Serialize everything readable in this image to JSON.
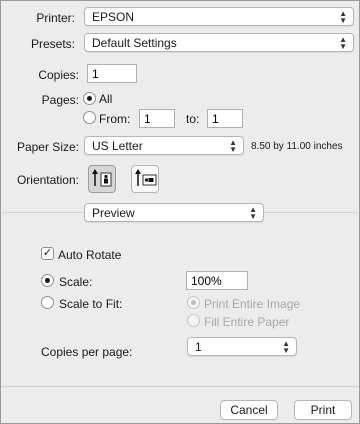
{
  "printer": {
    "label": "Printer:",
    "value": "EPSON"
  },
  "presets": {
    "label": "Presets:",
    "value": "Default Settings"
  },
  "copies": {
    "label": "Copies:",
    "value": "1"
  },
  "pages": {
    "label": "Pages:",
    "all_label": "All",
    "from_label": "From:",
    "from_value": "1",
    "to_label": "to:",
    "to_value": "1"
  },
  "paper_size": {
    "label": "Paper Size:",
    "value": "US Letter",
    "dimensions": "8.50 by 11.00 inches"
  },
  "orientation": {
    "label": "Orientation:",
    "selected": "portrait"
  },
  "section_select": {
    "value": "Preview"
  },
  "preview": {
    "auto_rotate_label": "Auto Rotate",
    "auto_rotate_checked": true,
    "scale_label": "Scale:",
    "scale_value": "100%",
    "scale_to_fit_label": "Scale to Fit:",
    "print_entire_image_label": "Print Entire Image",
    "fill_entire_paper_label": "Fill Entire Paper",
    "copies_per_page_label": "Copies per page:",
    "copies_per_page_value": "1"
  },
  "buttons": {
    "cancel": "Cancel",
    "print": "Print"
  },
  "icons": {
    "checkmark": "checkmark-icon",
    "chevron": "chevron-updown-icon",
    "portrait": "portrait-orientation-icon",
    "landscape": "landscape-orientation-icon"
  }
}
